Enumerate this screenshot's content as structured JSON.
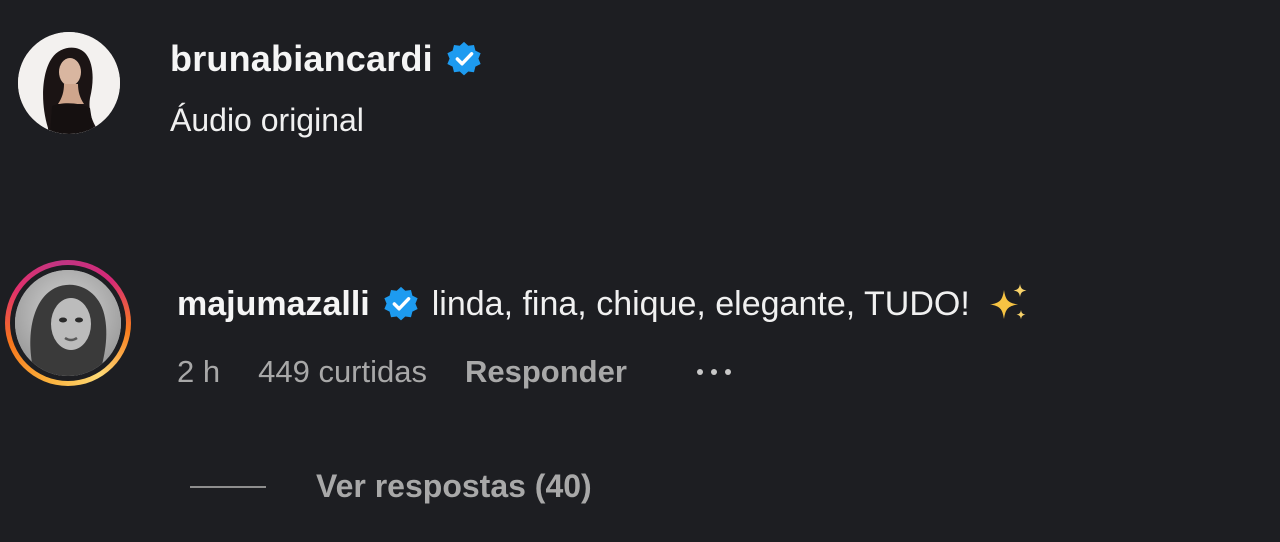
{
  "post": {
    "username": "brunabiancardi",
    "audio": "Áudio original",
    "avatar_icon": "profile-photo-icon"
  },
  "comment": {
    "username": "majumazalli",
    "text": "linda, fina, chique, elegante, TUDO!",
    "emoji": "sparkles-icon",
    "time": "2 h",
    "likes": "449 curtidas",
    "reply_label": "Responder",
    "more_icon": "more-options-icon"
  },
  "replies": {
    "label": "Ver respostas (40)"
  },
  "colors": {
    "background": "#1d1e22",
    "text_primary": "#f5f5f5",
    "text_secondary": "#a8a8a8",
    "verified_blue": "#1d9bf0"
  }
}
